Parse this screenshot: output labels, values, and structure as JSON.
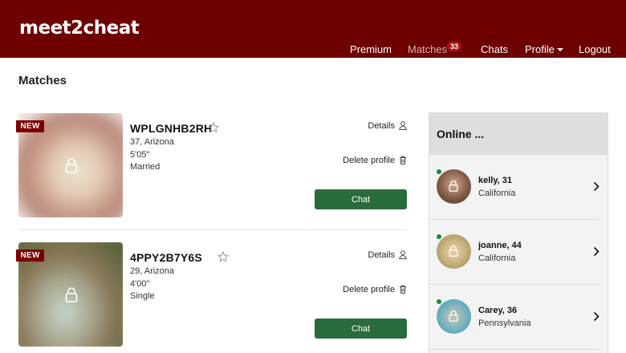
{
  "header": {
    "logo": "meet2cheat",
    "nav": {
      "premium": "Premium",
      "matches": "Matches",
      "matches_badge": "33",
      "chats": "Chats",
      "profile": "Profile",
      "logout": "Logout"
    },
    "brand_color": "#6e0000"
  },
  "page_title": "Matches",
  "matches": [
    {
      "badge": "NEW",
      "username": "WPLGNHB2RH",
      "age_location": "37, Arizona",
      "height": "5'05\"",
      "status": "Married",
      "details_label": "Details",
      "delete_label": "Delete profile",
      "chat_label": "Chat",
      "photo_icon": "lock-icon",
      "favorite_icon": "star-outline-icon"
    },
    {
      "badge": "NEW",
      "username": "4PPY2B7Y6S",
      "age_location": "29, Arizona",
      "height": "4'00\"",
      "status": "Single",
      "details_label": "Details",
      "delete_label": "Delete profile",
      "chat_label": "Chat",
      "photo_icon": "lock-icon",
      "favorite_icon": "star-outline-icon"
    }
  ],
  "online": {
    "title": "Online ...",
    "users": [
      {
        "name": "kelly, 31",
        "location": "California"
      },
      {
        "name": "joanne, 44",
        "location": "California"
      },
      {
        "name": "Carey, 36",
        "location": "Pennsylvania"
      }
    ]
  },
  "colors": {
    "chat_button": "#2a6b3c",
    "online_dot": "#1d8a3a",
    "new_badge": "#7a0000"
  }
}
